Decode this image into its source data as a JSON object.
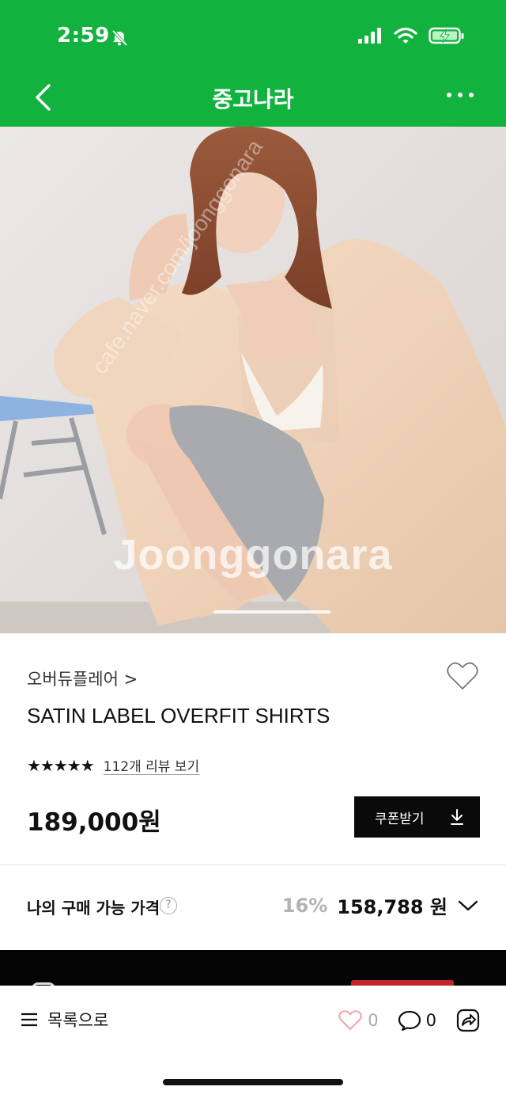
{
  "status_bar": {
    "time": "2:59"
  },
  "nav": {
    "title": "중고나라"
  },
  "hero": {
    "watermark": "Joonggonara",
    "diagonal": "cafe.naver.com/joonggonara"
  },
  "product": {
    "brand": "오버듀플레어 >",
    "title": "SATIN LABEL OVERFIT SHIRTS",
    "stars": "★★★★★",
    "rating": 5,
    "review_link": "112개 리뷰 보기",
    "price": "189,000원",
    "coupon_label": "쿠폰받기"
  },
  "my_price": {
    "label": "나의 구매 가능 가격",
    "help": "?",
    "discount": "16%",
    "value": "158,788 원"
  },
  "bottom_bar": {
    "list_label": "목록으로",
    "like_count": "0",
    "comment_count": "0"
  },
  "colors": {
    "brand_green": "#12b23f",
    "like_pink": "#f3a3a8"
  }
}
